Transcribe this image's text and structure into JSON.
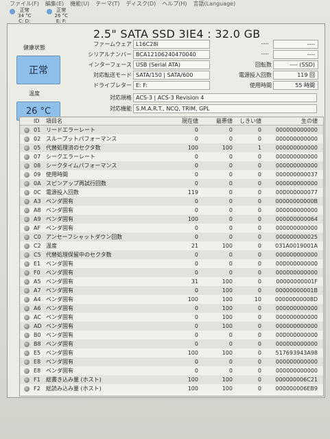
{
  "menu": [
    "ファイル(F)",
    "編集(E)",
    "機能(U)",
    "テーマ(T)",
    "ディスク(D)",
    "ヘルプ(H)",
    "言語(Language)"
  ],
  "drives": [
    {
      "status": "正常",
      "temp": "34 °C",
      "letter": "C: D:"
    },
    {
      "status": "正常",
      "temp": "26 °C",
      "letter": "E: F:"
    }
  ],
  "title": "2.5\" SATA SSD 3IE4 : 32.0 GB",
  "health": {
    "label": "健康状態",
    "value": "正常"
  },
  "temperature": {
    "label": "温度",
    "value": "26 °C"
  },
  "info": {
    "firmware_label": "ファームウェア",
    "firmware": "L16C28i",
    "serial_label": "シリアルナンバー",
    "serial": "BCA12106240470040",
    "interface_label": "インターフェース",
    "interface": "USB (Serial ATA)",
    "transfer_label": "対応転送モード",
    "transfer": "SATA/150 | SATA/600",
    "letter_label": "ドライブレター",
    "letter": "E: F:",
    "standard_label": "対応規格",
    "standard": "ACS-3 | ACS-3 Revision 4",
    "features_label": "対応機能",
    "features": "S.M.A.R.T., NCQ, TRIM, GPL",
    "r1_left": "----",
    "r1_right": "----",
    "r2_left": "----",
    "r2_right": "----",
    "rpm_label": "回転数",
    "rpm": "---- (SSD)",
    "poweron_count_label": "電源投入回数",
    "poweron_count": "119 回",
    "hours_label": "使用時間",
    "hours": "55 時間"
  },
  "table": {
    "headers": [
      "ID",
      "項目名",
      "現在値",
      "最悪値",
      "しきい値",
      "生の値"
    ],
    "rows": [
      [
        "01",
        "リードエラーレート",
        "0",
        "0",
        "0",
        "000000000000"
      ],
      [
        "02",
        "スループットパフォーマンス",
        "0",
        "0",
        "0",
        "000000000000"
      ],
      [
        "05",
        "代替処理済のセクタ数",
        "100",
        "100",
        "1",
        "000000000000"
      ],
      [
        "07",
        "シークエラーレート",
        "0",
        "0",
        "0",
        "000000000000"
      ],
      [
        "08",
        "シークタイムパフォーマンス",
        "0",
        "0",
        "0",
        "000000000000"
      ],
      [
        "09",
        "使用時間",
        "0",
        "0",
        "0",
        "000000000037"
      ],
      [
        "0A",
        "スピンアップ再試行回数",
        "0",
        "0",
        "0",
        "000000000000"
      ],
      [
        "0C",
        "電源投入回数",
        "119",
        "0",
        "0",
        "000000000077"
      ],
      [
        "A3",
        "ベンダ固有",
        "0",
        "0",
        "0",
        "00000000000B"
      ],
      [
        "A8",
        "ベンダ固有",
        "0",
        "0",
        "0",
        "000000000000"
      ],
      [
        "A9",
        "ベンダ固有",
        "100",
        "0",
        "0",
        "000000000064"
      ],
      [
        "AF",
        "ベンダ固有",
        "0",
        "0",
        "0",
        "000000000000"
      ],
      [
        "C0",
        "アンセーフシャットダウン回数",
        "0",
        "0",
        "0",
        "000000000025"
      ],
      [
        "C2",
        "温度",
        "21",
        "100",
        "0",
        "031A0019001A"
      ],
      [
        "C5",
        "代替処理保留中のセクタ数",
        "0",
        "0",
        "0",
        "000000000000"
      ],
      [
        "E1",
        "ベンダ固有",
        "0",
        "0",
        "0",
        "000000000000"
      ],
      [
        "F0",
        "ベンダ固有",
        "0",
        "0",
        "0",
        "000000000000"
      ],
      [
        "A5",
        "ベンダ固有",
        "31",
        "100",
        "0",
        "00000000001F"
      ],
      [
        "A7",
        "ベンダ固有",
        "0",
        "100",
        "0",
        "00000000001B"
      ],
      [
        "A4",
        "ベンダ固有",
        "100",
        "100",
        "10",
        "00000000008D"
      ],
      [
        "A6",
        "ベンダ固有",
        "0",
        "100",
        "0",
        "000000000000"
      ],
      [
        "AC",
        "ベンダ固有",
        "0",
        "100",
        "0",
        "000000000000"
      ],
      [
        "AD",
        "ベンダ固有",
        "0",
        "100",
        "0",
        "000000000000"
      ],
      [
        "B0",
        "ベンダ固有",
        "0",
        "0",
        "0",
        "000000000000"
      ],
      [
        "B8",
        "ベンダ固有",
        "0",
        "0",
        "0",
        "000000000000"
      ],
      [
        "E5",
        "ベンダ固有",
        "100",
        "100",
        "0",
        "517693943A98"
      ],
      [
        "E8",
        "ベンダ固有",
        "0",
        "0",
        "0",
        "000000000000"
      ],
      [
        "E8",
        "ベンダ固有",
        "0",
        "0",
        "0",
        "000000000000"
      ],
      [
        "F1",
        "総書き込み量 (ホスト)",
        "100",
        "100",
        "0",
        "000000006C21"
      ],
      [
        "F2",
        "総読み込み量 (ホスト)",
        "100",
        "100",
        "0",
        "000000006EB9"
      ]
    ]
  }
}
